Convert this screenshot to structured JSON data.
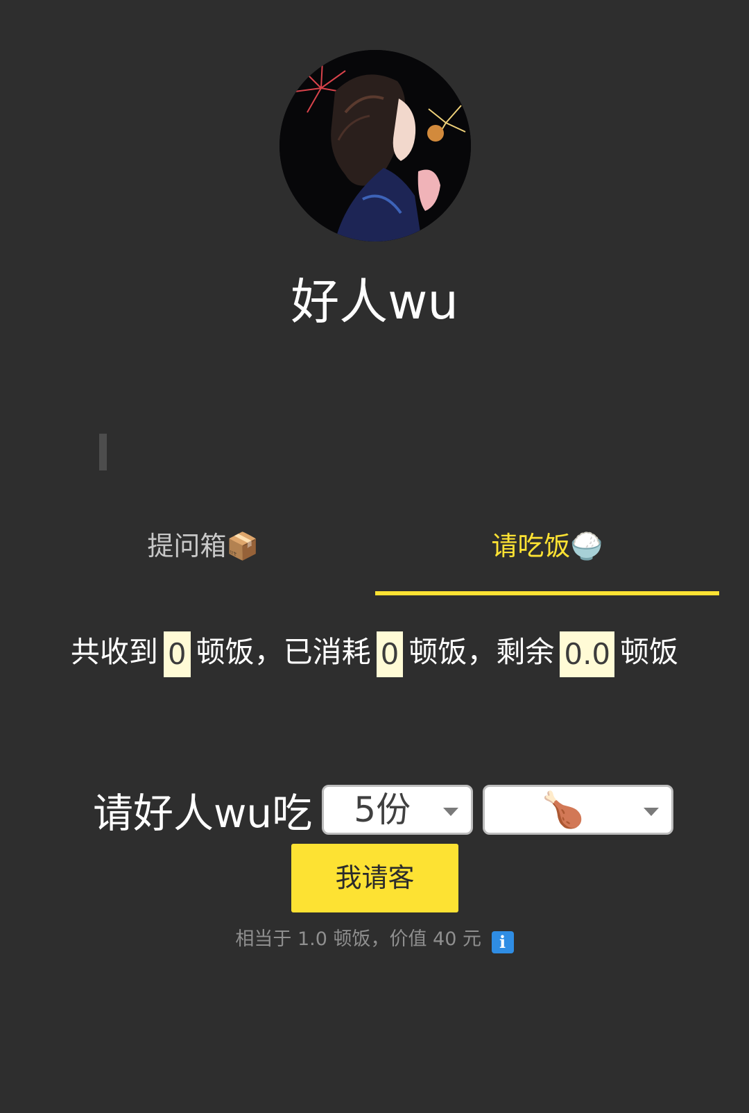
{
  "profile": {
    "name": "好人wu",
    "avatar_alt": "avatar"
  },
  "tabs": [
    {
      "label": "提问箱📦",
      "active": false
    },
    {
      "label": "请吃饭🍚",
      "active": true
    }
  ],
  "stats": {
    "received_prefix": "共收到",
    "received_count": "0",
    "consumed_prefix": "顿饭，已消耗",
    "consumed_count": "0",
    "remaining_prefix": "顿饭，剩余",
    "remaining_count": "0.0",
    "suffix": "顿饭"
  },
  "treat": {
    "label": "请好人wu吃",
    "quantity_selected": "5份",
    "food_selected": "🍗",
    "button_label": "我请客",
    "note": "相当于 1.0 顿饭，价值 40 元",
    "info_icon": "i"
  },
  "colors": {
    "background": "#2e2e2e",
    "accent": "#fde233",
    "highlight": "#fffbd6",
    "muted": "#8f8f8f"
  }
}
